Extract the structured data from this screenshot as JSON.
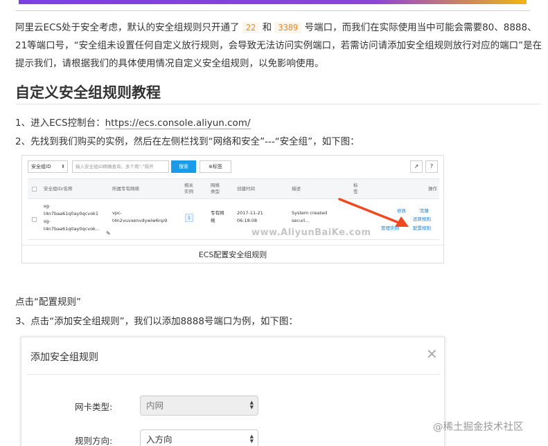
{
  "intro": {
    "p1": "阿里云ECS处于安全考虑，默认的安全组规则只开通了 ",
    "port1": "22",
    "p2": " 和 ",
    "port2": "3389",
    "p3": " 号端口，而我们在实际使用当中可能会需要80、8888、21等端口号，“安全组未设置任何自定义放行规则，会导致无法访问实例端口，若需访问请添加安全组规则放行对应的端口”是在提示我们，请根据我们的具体使用情况自定义安全组规则，以免影响使用。"
  },
  "heading": "自定义安全组规则教程",
  "steps": {
    "s1_prefix": "1、进入ECS控制台：",
    "s1_link": "https://ecs.console.aliyun.com/",
    "s2": "2、先找到我们购买的实例，然后在左侧栏找到“网络和安全”---“安全组”，如下图：",
    "click_note": "点击“配置规则”",
    "s3": "3、点击“添加安全组规则”，我们以添加8888号端口为例，如下图："
  },
  "ecs_shot": {
    "select_label": "安全组ID",
    "search_placeholder": "输入安全组ID精确查询，多个用\",\"隔开",
    "search_btn": "搜索",
    "tag_btn": "标签",
    "cols": {
      "id": "安全组ID/名称",
      "vpc": "所属专有网络",
      "instances": "相关实例",
      "net_type": "网络类型",
      "created": "创建时间",
      "desc": "描述",
      "tag": "标签",
      "ops": "操作"
    },
    "row": {
      "id1": "sg-",
      "id2": "t4n7baa61q0ay0qcvok1",
      "id3": "sg-",
      "id4": "t4n7baa61q0ay0qcvok...",
      "vpc1": "vpc-",
      "vpc2": "t4n2vuvxenvdywiw6np9",
      "count": "1",
      "net1": "专有网",
      "net2": "络",
      "date": "2017-11-21",
      "time": "06:18:08",
      "desc1": "System created",
      "desc2": "securi...",
      "op_modify": "修改",
      "op_clone": "克隆",
      "op_restore": "还原规则",
      "op_manage": "管理实例",
      "op_config": "配置规则"
    },
    "watermark": "www.AliyunBaiKe.com",
    "caption": "ECS配置安全组规则"
  },
  "dialog": {
    "title": "添加安全组规则",
    "nic_label": "网卡类型:",
    "nic_value": "内网",
    "dir_label": "规则方向:",
    "dir_value": "入方向"
  },
  "watermark_site": "@稀土掘金技术社区",
  "colors": {
    "accent_blue": "#1a9be8",
    "arrow_red": "#f0481f",
    "code_orange": "#e6892b"
  }
}
